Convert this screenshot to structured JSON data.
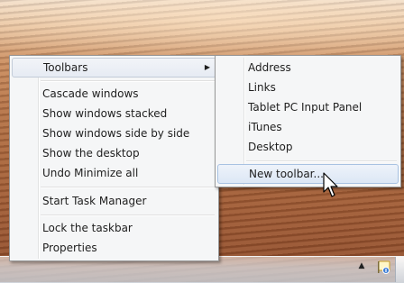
{
  "menu": {
    "toolbars_label": "Toolbars",
    "cascade_label": "Cascade windows",
    "stacked_label": "Show windows stacked",
    "side_by_side_label": "Show windows side by side",
    "show_desktop_label": "Show the desktop",
    "undo_minimize_label": "Undo Minimize all",
    "task_manager_label": "Start Task Manager",
    "lock_taskbar_label": "Lock the taskbar",
    "properties_label": "Properties"
  },
  "submenu": {
    "address_label": "Address",
    "links_label": "Links",
    "tablet_label": "Tablet PC Input Panel",
    "itunes_label": "iTunes",
    "desktop_label": "Desktop",
    "new_toolbar_label": "New toolbar..."
  },
  "tray": {
    "arrow_glyph": "▲"
  },
  "icons": {
    "submenu_arrow": "chevron-right-icon",
    "cursor": "mouse-pointer-icon",
    "tray_app": "action-center-flag-icon"
  }
}
